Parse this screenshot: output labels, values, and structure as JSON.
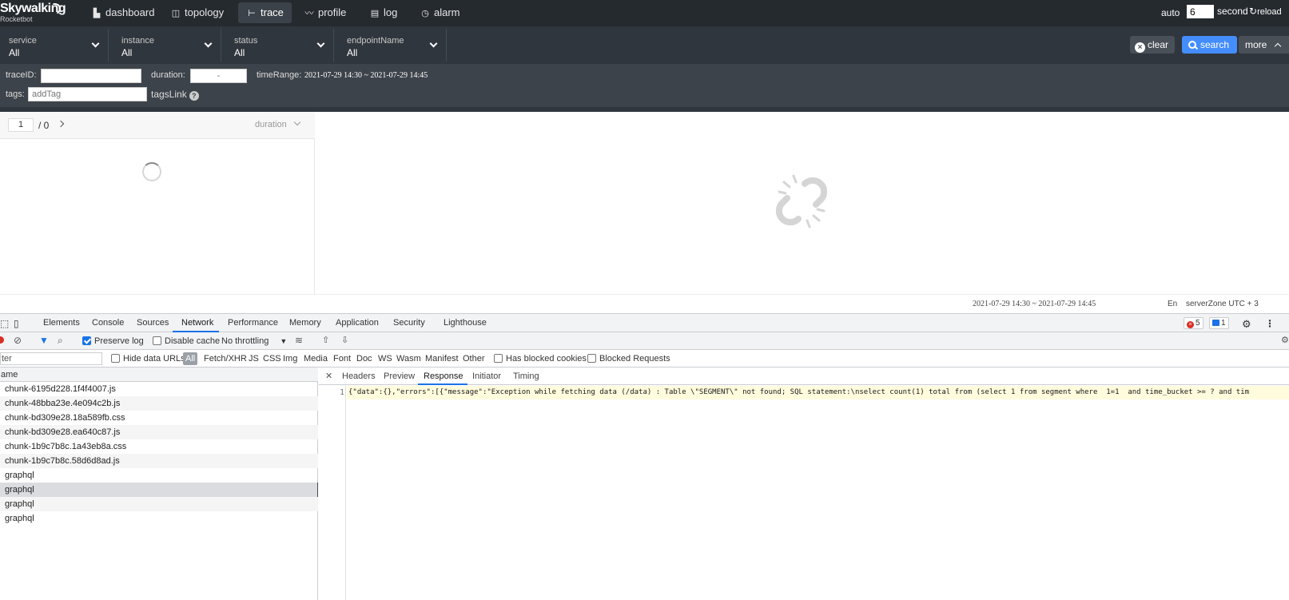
{
  "app": {
    "logo_main": "Skywalking",
    "logo_sub": "Rocketbot"
  },
  "nav": {
    "items": [
      {
        "label": "dashboard",
        "icon": "bar-chart-icon"
      },
      {
        "label": "topology",
        "icon": "topology-icon"
      },
      {
        "label": "trace",
        "icon": "trace-icon",
        "active": true
      },
      {
        "label": "profile",
        "icon": "line-chart-icon"
      },
      {
        "label": "log",
        "icon": "log-icon"
      },
      {
        "label": "alarm",
        "icon": "alarm-icon"
      }
    ],
    "auto_label": "auto",
    "auto_value": "6",
    "second_label": "second",
    "reload_label": "reload"
  },
  "filters": {
    "selects": [
      {
        "label": "service",
        "value": "All"
      },
      {
        "label": "instance",
        "value": "All"
      },
      {
        "label": "status",
        "value": "All"
      },
      {
        "label": "endpointName",
        "value": "All"
      }
    ],
    "clear_label": "clear",
    "search_label": "search",
    "more_label": "more"
  },
  "options": {
    "traceid_label": "traceID:",
    "traceid_value": "",
    "duration_label": "duration:",
    "duration_value": "-",
    "timerange_label": "timeRange:",
    "timerange_value": "2021-07-29 14:30 ~ 2021-07-29 14:45",
    "tags_label": "tags:",
    "tags_placeholder": "addTag",
    "tagslink_label": "tagsLink"
  },
  "trace_list": {
    "page_current": "1",
    "page_total": "/ 0",
    "sort_label": "duration"
  },
  "statusbar": {
    "timerange": "2021-07-29 14:30 ~ 2021-07-29 14:45",
    "lang": "En",
    "server_zone": "serverZone UTC + 3"
  },
  "devtools": {
    "tabs": [
      "Elements",
      "Console",
      "Sources",
      "Network",
      "Performance",
      "Memory",
      "Application",
      "Security",
      "Lighthouse"
    ],
    "active_tab": "Network",
    "errors_count": "5",
    "messages_count": "1",
    "toolbar": {
      "preserve_log": "Preserve log",
      "disable_cache": "Disable cache",
      "throttling": "No throttling"
    },
    "filter": {
      "input_value": "ter",
      "hide_data_urls": "Hide data URLs",
      "types": [
        "All",
        "Fetch/XHR",
        "JS",
        "CSS",
        "Img",
        "Media",
        "Font",
        "Doc",
        "WS",
        "Wasm",
        "Manifest",
        "Other"
      ],
      "has_blocked_cookies": "Has blocked cookies",
      "blocked_requests": "Blocked Requests"
    },
    "requests_header": "ame",
    "requests": [
      "chunk-6195d228.1f4f4007.js",
      "chunk-48bba23e.4e094c2b.js",
      "chunk-bd309e28.18a589fb.css",
      "chunk-bd309e28.ea640c87.js",
      "chunk-1b9c7b8c.1a43eb8a.css",
      "chunk-1b9c7b8c.58d6d8ad.js",
      "graphql",
      "graphql",
      "graphql",
      "graphql"
    ],
    "selected_request_index": 7,
    "response_tabs": [
      "Headers",
      "Preview",
      "Response",
      "Initiator",
      "Timing"
    ],
    "active_response_tab": "Response",
    "response_line_number": "1",
    "response_text": "{\"data\":{},\"errors\":[{\"message\":\"Exception while fetching data (/data) : Table \\\"SEGMENT\\\" not found; SQL statement:\\nselect count(1) total from (select 1 from segment where  1=1  and time_bucket >= ? and tim"
  },
  "colors": {
    "nav_bg": "#252a2f",
    "filter_bg": "#30363d",
    "options_bg": "#3d434a",
    "accent_blue": "#448dfe",
    "devtools_blue": "#1a73e8",
    "response_highlight": "#fffbdd"
  }
}
